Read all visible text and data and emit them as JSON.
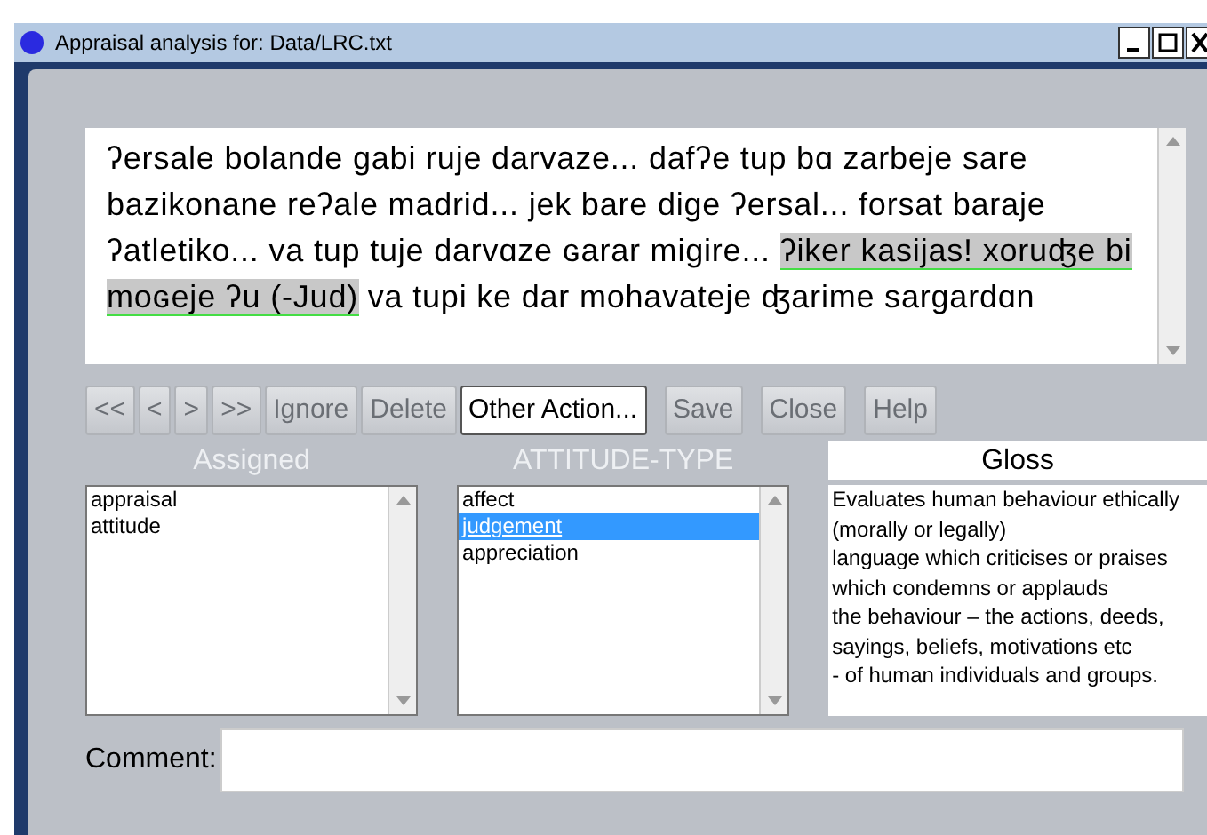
{
  "window": {
    "title": "Appraisal analysis for: Data/LRC.txt"
  },
  "text": {
    "segments": [
      {
        "text": "ʔersale bolande gabi ruje darvaze... dafʔe tup bɑ zarbeje sare bazikonane reʔale madrid... jek bare dige ʔersal... forsat baraje ʔatletiko... va tup tuje darvɑze ɢarar migire... ",
        "highlighted": false
      },
      {
        "text": "ʔiker kasijas! xoruʤe bi moɢeje ʔu (-Jud)",
        "highlighted": true
      },
      {
        "text": " va tupi ke dar mohavateje ʤarime sargardɑn",
        "highlighted": false
      }
    ]
  },
  "buttons": [
    {
      "label": "<<",
      "disabled": true
    },
    {
      "label": "<",
      "disabled": true
    },
    {
      "label": ">",
      "disabled": true
    },
    {
      "label": ">>",
      "disabled": true
    },
    {
      "label": "Ignore",
      "disabled": true
    },
    {
      "label": "Delete",
      "disabled": true
    },
    {
      "label": "Other Action...",
      "disabled": false
    },
    {
      "label": "Save",
      "disabled": true
    },
    {
      "label": "Close",
      "disabled": true
    },
    {
      "label": "Help",
      "disabled": true
    }
  ],
  "assigned": {
    "heading": "Assigned",
    "items": [
      {
        "label": "appraisal",
        "selected": false
      },
      {
        "label": "attitude",
        "selected": false
      }
    ]
  },
  "attitude_type": {
    "heading": "ATTITUDE-TYPE",
    "items": [
      {
        "label": "affect",
        "selected": false
      },
      {
        "label": "judgement",
        "selected": true
      },
      {
        "label": "appreciation",
        "selected": false
      }
    ]
  },
  "gloss": {
    "heading": "Gloss",
    "lines": [
      "Evaluates human behaviour ethically",
      "(morally or legally)",
      "language which criticises or praises",
      "which condemns or applauds",
      "the behaviour – the actions, deeds,",
      "sayings, beliefs, motivations etc",
      "- of human individuals and groups."
    ]
  },
  "comment": {
    "label": "Comment:"
  }
}
